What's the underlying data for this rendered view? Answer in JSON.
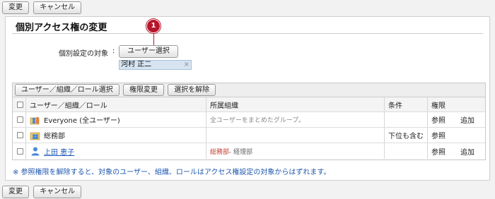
{
  "toolbar": {
    "change": "変更",
    "cancel": "キャンセル"
  },
  "panel": {
    "title": "個別アクセス権の変更",
    "badge": "1",
    "target_label": "個別設定の対象",
    "colon": ":",
    "user_select": "ユーザー選択",
    "selected_user": "河村 正二",
    "remove_mark": "×"
  },
  "table": {
    "buttons": [
      "ユーザー／組織／ロール選択",
      "権限変更",
      "選択を解除"
    ],
    "headers": {
      "name": "ユーザー／組織／ロール",
      "org": "所属組織",
      "cond": "条件",
      "perm": "権限"
    },
    "rows": [
      {
        "name": "Everyone (全ユーザー)",
        "org": "全ユーザーをまとめたグループ。",
        "cond": "",
        "perm": "参照",
        "add": "追加",
        "icon": "group-everyone-icon"
      },
      {
        "name": "総務部",
        "org": "",
        "cond": "下位も含む",
        "perm": "参照",
        "add": "",
        "icon": "organization-icon"
      },
      {
        "name": "上田 恵子",
        "org_primary": "総務部",
        "org_sep": ",",
        "org_secondary": "経理部",
        "cond": "",
        "perm": "参照",
        "add": "追加",
        "icon": "user-icon"
      }
    ]
  },
  "note": "※ 参照権限を解除すると、対象のユーザー、組織、ロールはアクセス権設定の対象からはずれます。",
  "colors": {
    "badge": "#b5162b",
    "link": "#1a55b5",
    "org_primary": "#c0392b"
  }
}
